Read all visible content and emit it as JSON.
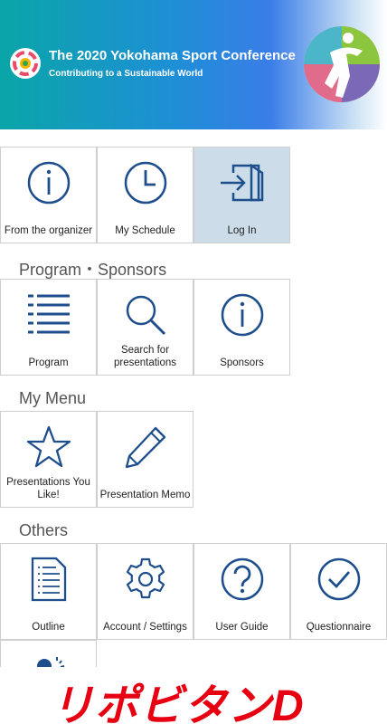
{
  "header": {
    "title": "The 2020 Yokohama Sport Conference",
    "subtitle": "Contributing to a Sustainable World"
  },
  "sections": {
    "program_sponsors": "Program・Sponsors",
    "my_menu": "My Menu",
    "others": "Others"
  },
  "tiles": {
    "from_organizer": "From the organizer",
    "my_schedule": "My Schedule",
    "log_in": "Log In",
    "program": "Program",
    "search_presentations": "Search for presentations",
    "sponsors": "Sponsors",
    "presentations_liked": "Presentations You Like!",
    "presentation_memo": "Presentation Memo",
    "outline": "Outline",
    "account_settings": "Account / Settings",
    "user_guide": "User Guide",
    "questionnaire": "Questionnaire"
  },
  "banner": {
    "text": "リポビタンD"
  },
  "colors": {
    "icon": "#1f4e8c",
    "active_tile": "#ccdde9",
    "banner_red": "#e60012"
  }
}
